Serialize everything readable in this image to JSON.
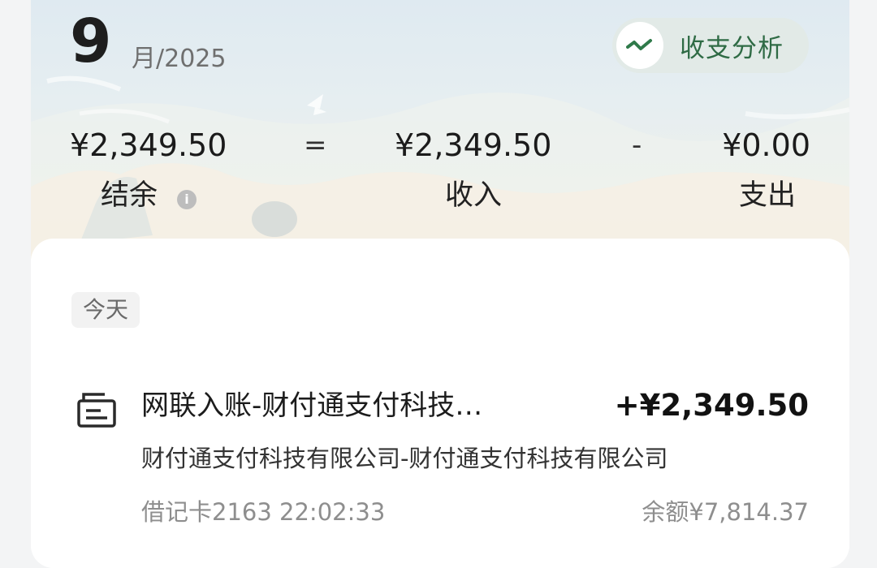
{
  "header": {
    "month": "9",
    "month_suffix": "月/2025",
    "analysis_label": "收支分析",
    "analysis_icon": "trend-line-icon"
  },
  "summary": {
    "balance_value": "¥2,349.50",
    "balance_label": "结余",
    "equals": "=",
    "income_value": "¥2,349.50",
    "income_label": "收入",
    "minus": "-",
    "expense_value": "¥0.00",
    "expense_label": "支出",
    "info_icon": "info-icon"
  },
  "list": {
    "day_label": "今天",
    "transactions": [
      {
        "icon": "receipt-icon",
        "title": "网联入账-财付通支付科技…",
        "amount": "+¥2,349.50",
        "description": "财付通支付科技有限公司-财付通支付科技有限公司",
        "account_time": "借记卡2163 22:02:33",
        "balance": "余额¥7,814.37"
      }
    ]
  },
  "colors": {
    "accent_green": "#2f6b45",
    "amount_text": "#121212",
    "muted_text": "#8e8e8e"
  }
}
